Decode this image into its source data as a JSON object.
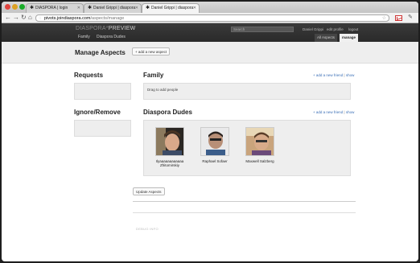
{
  "browser": {
    "tabs": [
      {
        "label": "DIASPORA | login"
      },
      {
        "label": "Daniel Grippi | diaspora"
      },
      {
        "label": "Daniel Grippi | diaspora"
      }
    ],
    "url_host": "pivots.joindiaspora.com",
    "url_path": "/aspects/manage"
  },
  "header": {
    "logo_main": "DIASPORA*",
    "logo_preview": "PREVIEW",
    "nav": [
      "Family",
      "Diaspora Dudes"
    ],
    "search_placeholder": "Search",
    "user_links": [
      "Daniel Grippi",
      "edit profile",
      "logout"
    ],
    "tabs": [
      "All Aspects",
      "manage"
    ]
  },
  "page": {
    "title": "Manage Aspects",
    "add_aspect_label": "+ add a new aspect",
    "requests_title": "Requests",
    "ignore_title": "Ignore/Remove",
    "update_label": "Update Aspects",
    "footer": "DEBUG INFO"
  },
  "aspects": [
    {
      "name": "Family",
      "add_link": "+ add a new friend",
      "show_link": "show",
      "empty_hint": "Drag to add people",
      "people": []
    },
    {
      "name": "Diaspora Dudes",
      "add_link": "+ add a new friend",
      "show_link": "show",
      "people": [
        {
          "name": "Ilyaaaaaaaaaaaa Zhitomirskiy"
        },
        {
          "name": "Raphael Sofaer"
        },
        {
          "name": "Maxwell Salzberg"
        }
      ]
    }
  ],
  "colors": {
    "header_bg": "#2f2f2f",
    "link": "#3b6fb6",
    "panel_bg": "#eeeeee"
  }
}
